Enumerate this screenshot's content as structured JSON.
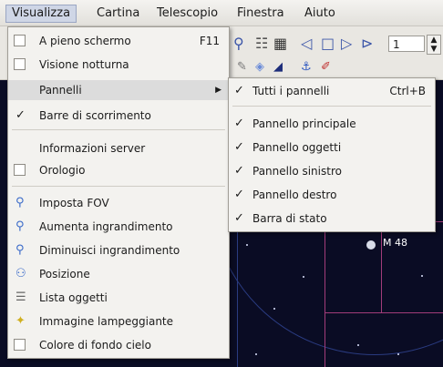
{
  "menubar": [
    {
      "label": "Visualizza",
      "active": true
    },
    {
      "label": "Cartina"
    },
    {
      "label": "Telescopio"
    },
    {
      "label": "Finestra"
    },
    {
      "label": "Aiuto"
    }
  ],
  "toolbar": {
    "spin_value": "1"
  },
  "main_menu": {
    "items": [
      {
        "label": "A pieno schermo",
        "shortcut": "F11",
        "checkbox": true,
        "checked": false
      },
      {
        "label": "Visione notturna",
        "checkbox": true,
        "checked": false
      },
      {
        "label": "Pannelli",
        "submenu": true,
        "highlighted": true
      },
      {
        "label": "Barre di scorrimento",
        "checked": true
      },
      {
        "label": "Informazioni server"
      },
      {
        "label": "Orologio",
        "checkbox": true,
        "checked": false
      },
      {
        "label": "Imposta FOV",
        "icon": "zoom-icon"
      },
      {
        "label": "Aumenta ingrandimento",
        "icon": "zoom-in-icon"
      },
      {
        "label": "Diminuisci ingrandimento",
        "icon": "zoom-out-icon"
      },
      {
        "label": "Posizione",
        "icon": "position-icon"
      },
      {
        "label": "Lista oggetti",
        "icon": "list-icon"
      },
      {
        "label": "Immagine lampeggiante",
        "icon": "lightbulb-icon"
      },
      {
        "label": "Colore di fondo cielo",
        "checkbox": true,
        "checked": false
      }
    ]
  },
  "submenu": {
    "items": [
      {
        "label": "Tutti i pannelli",
        "shortcut": "Ctrl+B",
        "checked": true
      },
      {
        "label": "Pannello principale",
        "checked": true
      },
      {
        "label": "Pannello oggetti",
        "checked": true
      },
      {
        "label": "Pannello sinistro",
        "checked": true
      },
      {
        "label": "Pannello destro",
        "checked": true
      },
      {
        "label": "Barra di stato",
        "checked": true
      }
    ]
  },
  "sky": {
    "object_label": "M 48"
  },
  "colors": {
    "sky": "#0a0c24",
    "boundary": "#a23c7a",
    "highlight": "#dcdcdc"
  }
}
